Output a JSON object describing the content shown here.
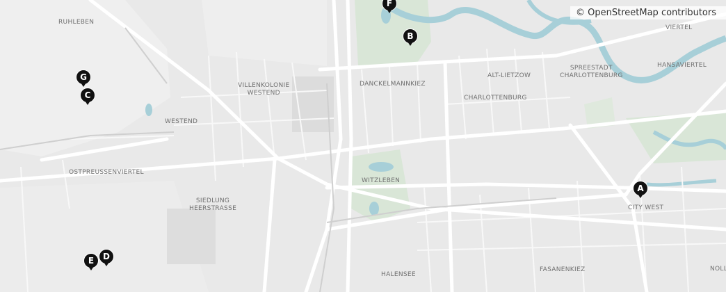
{
  "attribution": "© OpenStreetMap contributors",
  "colors": {
    "land": "#e9e9e9",
    "water": "#a7cfd8",
    "park": "#d9e6d7",
    "road": "#ffffff",
    "industrial": "#dcdcdc",
    "marker": "#111111"
  },
  "districts": [
    {
      "id": "ruhleben",
      "text": "RUHLEBEN"
    },
    {
      "id": "villenkolonie",
      "text": "VILLENKOLONIE\nWESTEND"
    },
    {
      "id": "westend",
      "text": "WESTEND"
    },
    {
      "id": "ostpreussenviertel",
      "text": "OSTPREUSSENVIERTEL"
    },
    {
      "id": "siedlung",
      "text": "SIEDLUNG\nHEERSTRASSE"
    },
    {
      "id": "danckelmannkiez",
      "text": "DANCKELMANNKIEZ"
    },
    {
      "id": "charlottenburg",
      "text": "CHARLOTTENBURG"
    },
    {
      "id": "alt-lietzow",
      "text": "ALT-LIETZOW"
    },
    {
      "id": "spreestadt",
      "text": "SPREESTADT\nCHARLOTTENBURG"
    },
    {
      "id": "viertel",
      "text": "VIERTEL"
    },
    {
      "id": "hansaviertel",
      "text": "HANSAVIERTEL"
    },
    {
      "id": "witzleben",
      "text": "WITZLEBEN"
    },
    {
      "id": "city-west",
      "text": "CITY WEST"
    },
    {
      "id": "halensee",
      "text": "HALENSEE"
    },
    {
      "id": "fasanenkiez",
      "text": "FASANENKIEZ"
    },
    {
      "id": "noll",
      "text": "NOLL"
    }
  ],
  "markers": [
    {
      "id": "a",
      "letter": "A"
    },
    {
      "id": "b",
      "letter": "B"
    },
    {
      "id": "c",
      "letter": "C"
    },
    {
      "id": "d",
      "letter": "D"
    },
    {
      "id": "e",
      "letter": "E"
    },
    {
      "id": "f",
      "letter": "F"
    },
    {
      "id": "g",
      "letter": "G"
    }
  ]
}
